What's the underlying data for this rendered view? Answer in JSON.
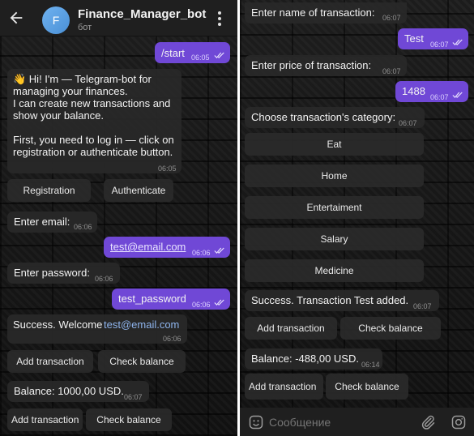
{
  "left": {
    "header": {
      "avatar_letter": "F",
      "title": "Finance_Manager_bot",
      "subtitle": "бот"
    },
    "messages": {
      "start": {
        "text": "/start",
        "time": "06:05"
      },
      "welcome": {
        "lines": [
          "👋 Hi! I'm — Telegram-bot for",
          "managing your finances.",
          "I can create new transactions and",
          "show your balance.",
          "",
          "First, you need to log in — click on",
          "registration or authenticate button."
        ],
        "time": "06:05"
      },
      "enter_email": {
        "text": "Enter email:",
        "time": "06:06"
      },
      "email": {
        "text": "test@email.com",
        "time": "06:06"
      },
      "enter_password": {
        "text": "Enter password:",
        "time": "06:06"
      },
      "password": {
        "text": "test_password",
        "time": "06:06"
      },
      "success": {
        "prefix": "Success. Welcome ",
        "email": "test@email.com",
        "time": "06:06"
      },
      "balance": {
        "text": "Balance: 1000,00 USD.",
        "time": "06:07"
      }
    },
    "buttons": {
      "registration": "Registration",
      "authenticate": "Authenticate",
      "add_transaction_1": "Add transaction",
      "check_balance_1": "Check balance",
      "add_transaction_2": "Add transaction",
      "check_balance_2": "Check balance"
    }
  },
  "right": {
    "messages": {
      "enter_name": {
        "text": "Enter name of transaction:",
        "time": "06:07"
      },
      "name": {
        "text": "Test",
        "time": "06:07"
      },
      "enter_price": {
        "text": "Enter price of transaction:",
        "time": "06:07"
      },
      "price": {
        "text": "1488",
        "time": "06:07"
      },
      "choose_category": {
        "text": "Choose transaction's category:",
        "time": "06:07"
      },
      "success": {
        "text": "Success. Transaction Test added.",
        "time": "06:07"
      },
      "balance": {
        "text": "Balance: -488,00 USD.",
        "time": "06:14"
      }
    },
    "categories": [
      "Eat",
      "Home",
      "Entertaiment",
      "Salary",
      "Medicine"
    ],
    "buttons": {
      "add_transaction_1": "Add transaction",
      "check_balance_1": "Check balance",
      "add_transaction_2": "Add transaction",
      "check_balance_2": "Check balance"
    },
    "composer": {
      "placeholder": "Сообщение"
    }
  },
  "colors": {
    "outgoing_bubble": "#7048d6",
    "incoming_bubble": "#282828",
    "link": "#8fb5ee",
    "header": "#1f1f1f"
  },
  "icons": [
    "back-arrow-icon",
    "more-vert-icon",
    "emoji-icon",
    "attach-icon",
    "camera-icon",
    "double-check-icon"
  ]
}
